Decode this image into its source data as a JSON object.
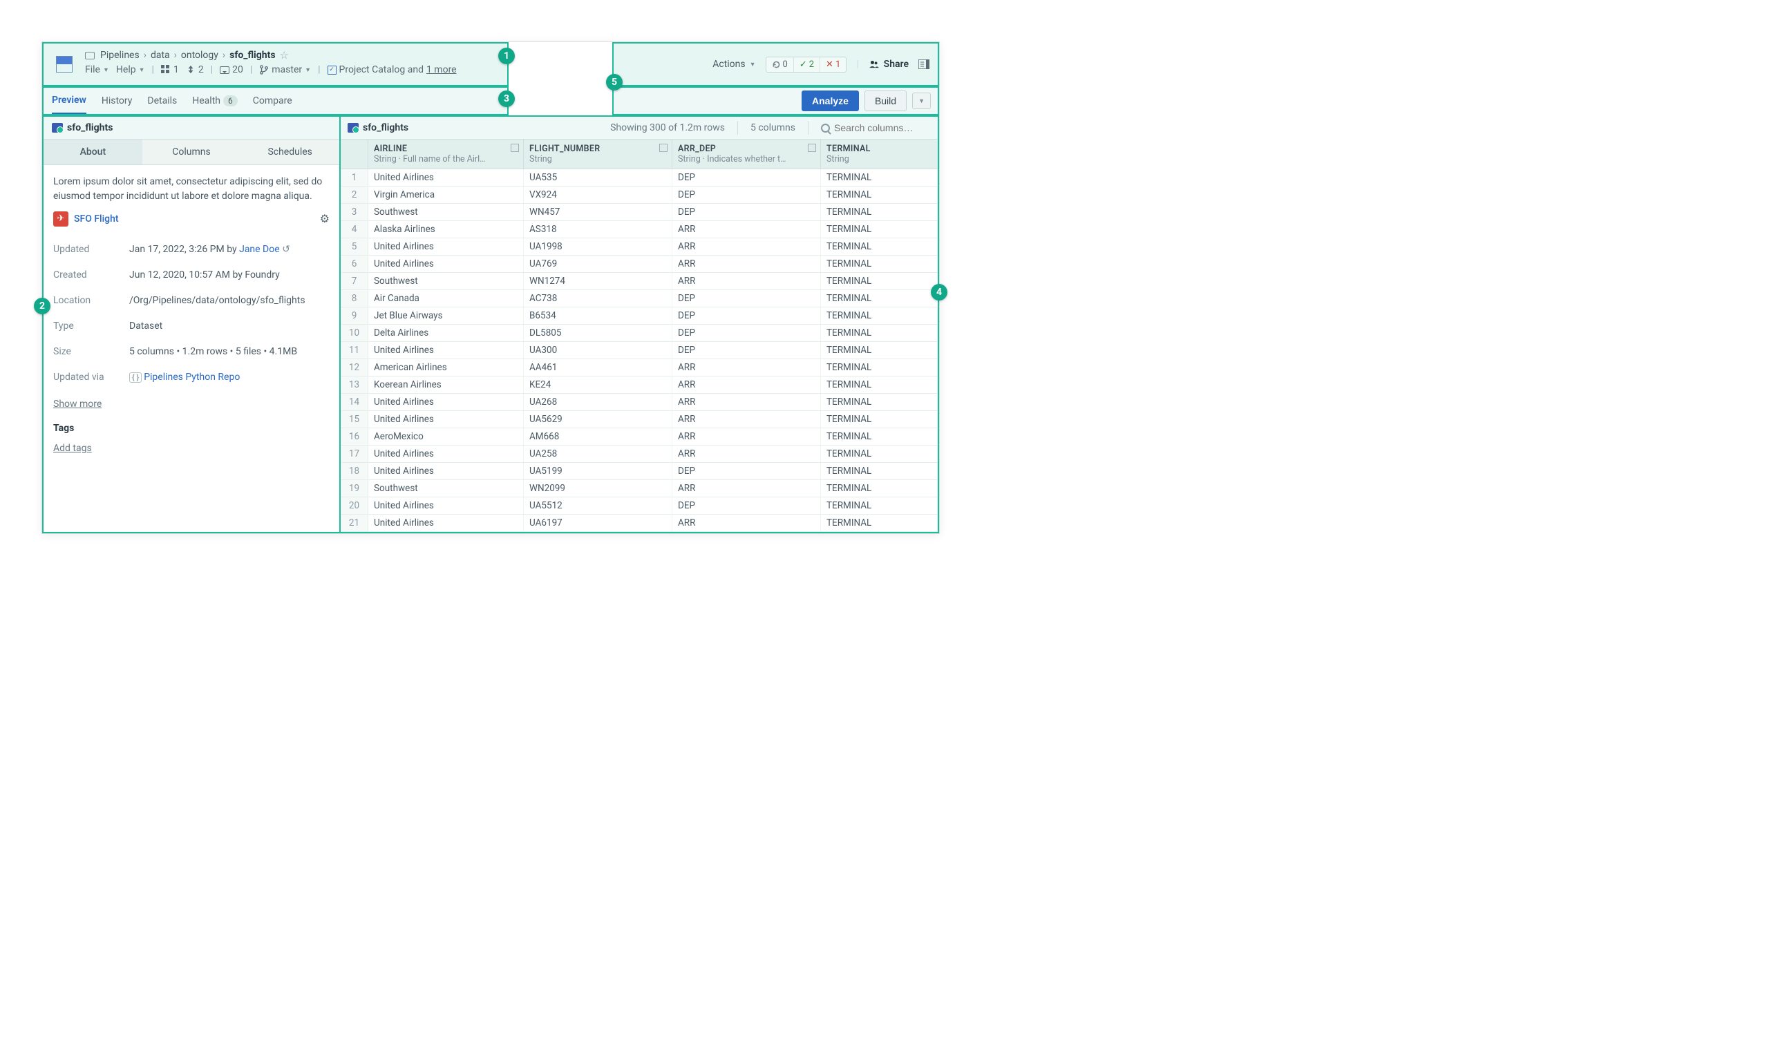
{
  "breadcrumb": {
    "root": "Pipelines",
    "segments": [
      "data",
      "ontology"
    ],
    "current": "sfo_flights"
  },
  "menubar": {
    "file": "File",
    "help": "Help",
    "grid_count": "1",
    "data_count": "2",
    "chat_count": "20",
    "branch": "master",
    "catalog_label": "Project Catalog and ",
    "catalog_more": "1 more"
  },
  "topright": {
    "actions": "Actions",
    "refresh_count": "0",
    "ok_count": "2",
    "err_count": "1",
    "share": "Share"
  },
  "tabs": {
    "items": [
      "Preview",
      "History",
      "Details",
      "Health",
      "Compare"
    ],
    "health_badge": "6",
    "analyze": "Analyze",
    "build": "Build"
  },
  "sidebar": {
    "title": "sfo_flights",
    "subtabs": [
      "About",
      "Columns",
      "Schedules"
    ],
    "description": "Lorem ipsum dolor sit amet, consectetur adipiscing elit, sed do eiusmod tempor incididunt ut labore et dolore magna aliqua.",
    "entity_label": "SFO Flight",
    "meta": {
      "updated_key": "Updated",
      "updated_val": "Jan 17, 2022, 3:26 PM by ",
      "updated_user": "Jane Doe",
      "created_key": "Created",
      "created_val": "Jun 12, 2020, 10:57 AM by Foundry",
      "location_key": "Location",
      "location_val": "/Org/Pipelines/data/ontology/sfo_flights",
      "type_key": "Type",
      "type_val": "Dataset",
      "size_key": "Size",
      "size_val": "5 columns • 1.2m rows • 5 files • 4.1MB",
      "via_key": "Updated via",
      "via_val": "Pipelines Python Repo",
      "show_more": "Show more"
    },
    "tags_head": "Tags",
    "add_tags": "Add tags"
  },
  "grid": {
    "title": "sfo_flights",
    "summary": "Showing 300 of 1.2m rows",
    "col_count": "5 columns",
    "search_placeholder": "Search columns…",
    "columns": [
      {
        "name": "AIRLINE",
        "sub": "String · Full name of the Airl…"
      },
      {
        "name": "FLIGHT_NUMBER",
        "sub": "String"
      },
      {
        "name": "ARR_DEP",
        "sub": "String · Indicates whether t…"
      },
      {
        "name": "TERMINAL",
        "sub": "String"
      }
    ],
    "rows": [
      {
        "airline": "United Airlines",
        "flight": "UA535",
        "ad": "DEP",
        "term": "TERMINAL"
      },
      {
        "airline": "Virgin America",
        "flight": "VX924",
        "ad": "DEP",
        "term": "TERMINAL"
      },
      {
        "airline": "Southwest",
        "flight": "WN457",
        "ad": "DEP",
        "term": "TERMINAL"
      },
      {
        "airline": "Alaska Airlines",
        "flight": "AS318",
        "ad": "ARR",
        "term": "TERMINAL"
      },
      {
        "airline": "United Airlines",
        "flight": "UA1998",
        "ad": "ARR",
        "term": "TERMINAL"
      },
      {
        "airline": "United Airlines",
        "flight": "UA769",
        "ad": "ARR",
        "term": "TERMINAL"
      },
      {
        "airline": "Southwest",
        "flight": "WN1274",
        "ad": "ARR",
        "term": "TERMINAL"
      },
      {
        "airline": "Air Canada",
        "flight": "AC738",
        "ad": "DEP",
        "term": "TERMINAL"
      },
      {
        "airline": "Jet Blue Airways",
        "flight": "B6534",
        "ad": "DEP",
        "term": "TERMINAL"
      },
      {
        "airline": "Delta Airlines",
        "flight": "DL5805",
        "ad": "DEP",
        "term": "TERMINAL"
      },
      {
        "airline": "United Airlines",
        "flight": "UA300",
        "ad": "DEP",
        "term": "TERMINAL"
      },
      {
        "airline": "American Airlines",
        "flight": "AA461",
        "ad": "ARR",
        "term": "TERMINAL"
      },
      {
        "airline": "Koerean Airlines",
        "flight": "KE24",
        "ad": "ARR",
        "term": "TERMINAL"
      },
      {
        "airline": "United Airlines",
        "flight": "UA268",
        "ad": "ARR",
        "term": "TERMINAL"
      },
      {
        "airline": "United Airlines",
        "flight": "UA5629",
        "ad": "ARR",
        "term": "TERMINAL"
      },
      {
        "airline": "AeroMexico",
        "flight": "AM668",
        "ad": "ARR",
        "term": "TERMINAL"
      },
      {
        "airline": "United Airlines",
        "flight": "UA258",
        "ad": "ARR",
        "term": "TERMINAL"
      },
      {
        "airline": "United Airlines",
        "flight": "UA5199",
        "ad": "DEP",
        "term": "TERMINAL"
      },
      {
        "airline": "Southwest",
        "flight": "WN2099",
        "ad": "ARR",
        "term": "TERMINAL"
      },
      {
        "airline": "United Airlines",
        "flight": "UA5512",
        "ad": "DEP",
        "term": "TERMINAL"
      },
      {
        "airline": "United Airlines",
        "flight": "UA6197",
        "ad": "ARR",
        "term": "TERMINAL"
      }
    ]
  },
  "callouts": [
    "1",
    "2",
    "3",
    "4",
    "5"
  ]
}
